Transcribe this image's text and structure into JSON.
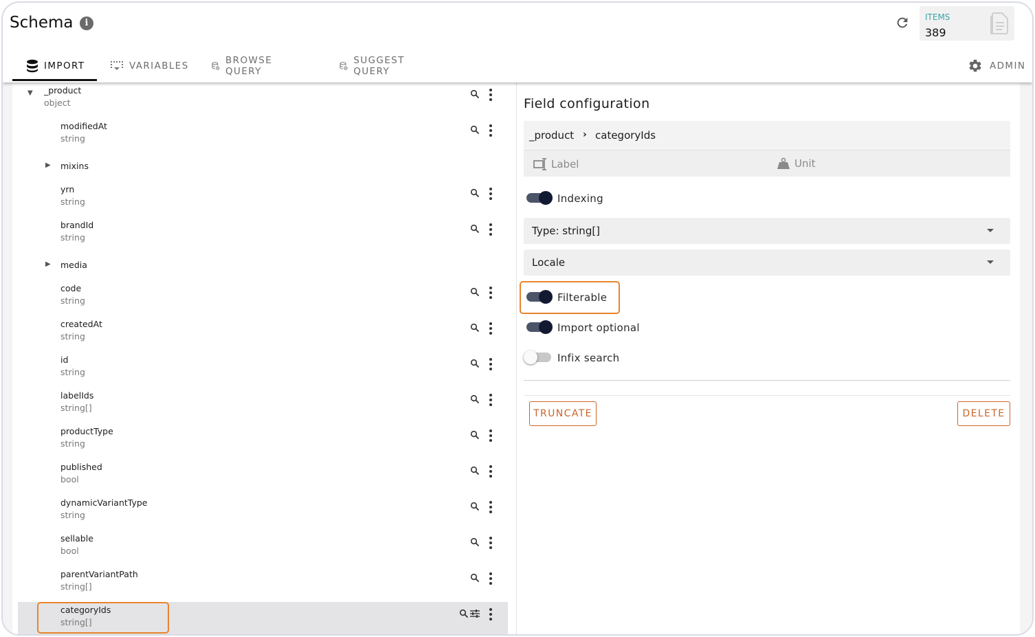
{
  "header": {
    "title": "Schema",
    "items_label": "ITEMS",
    "items_count": "389"
  },
  "tabs": [
    {
      "label": "IMPORT",
      "icon": "database-icon",
      "active": true
    },
    {
      "label": "VARIABLES",
      "icon": "variables-icon",
      "active": false
    },
    {
      "label": "BROWSE QUERY",
      "icon": "browse-query-icon",
      "active": false
    },
    {
      "label": "SUGGEST QUERY",
      "icon": "suggest-query-icon",
      "active": false
    }
  ],
  "admin_label": "ADMIN",
  "tree": {
    "root": {
      "name": "_product",
      "type": "object"
    },
    "fields": [
      {
        "name": "modifiedAt",
        "type": "string"
      },
      {
        "name": "mixins",
        "type": ""
      },
      {
        "name": "yrn",
        "type": "string"
      },
      {
        "name": "brandId",
        "type": "string"
      },
      {
        "name": "media",
        "type": ""
      },
      {
        "name": "code",
        "type": "string"
      },
      {
        "name": "createdAt",
        "type": "string"
      },
      {
        "name": "id",
        "type": "string"
      },
      {
        "name": "labelIds",
        "type": "string[]"
      },
      {
        "name": "productType",
        "type": "string"
      },
      {
        "name": "published",
        "type": "bool"
      },
      {
        "name": "dynamicVariantType",
        "type": "string"
      },
      {
        "name": "sellable",
        "type": "bool"
      },
      {
        "name": "parentVariantPath",
        "type": "string[]"
      },
      {
        "name": "categoryIds",
        "type": "string[]"
      }
    ]
  },
  "config": {
    "title": "Field configuration",
    "breadcrumb_parent": "_product",
    "breadcrumb_child": "categoryIds",
    "label_placeholder": "Label",
    "unit_placeholder": "Unit",
    "indexing_label": "Indexing",
    "indexing_on": true,
    "type_select": "Type: string[]",
    "locale_select": "Locale",
    "filterable_label": "Filterable",
    "filterable_on": true,
    "import_optional_label": "Import optional",
    "import_optional_on": true,
    "infix_label": "Infix search",
    "infix_on": false,
    "truncate_label": "TRUNCATE",
    "delete_label": "DELETE"
  },
  "colors": {
    "accent_orange": "#c9652a",
    "highlight_orange": "#e8832b",
    "items_label_teal": "#3aa3a8",
    "toggle_knob": "#121a33"
  }
}
